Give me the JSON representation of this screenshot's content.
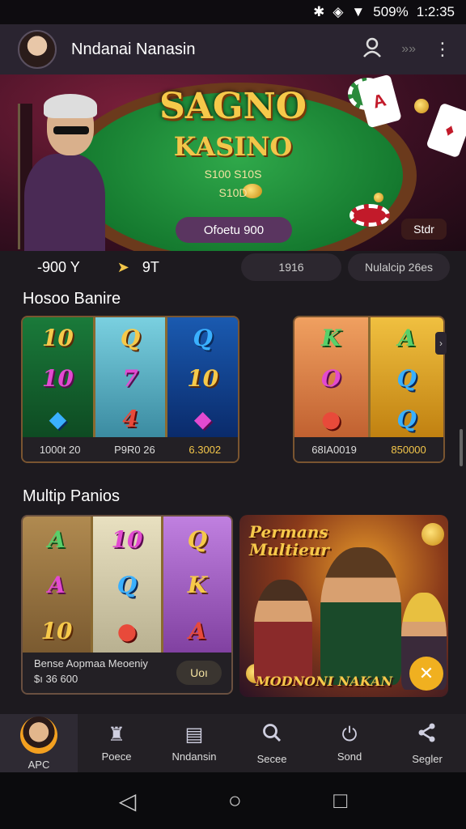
{
  "status_bar": {
    "battery": "​509%",
    "time": "1:2:35"
  },
  "header": {
    "title": "Nndanai Nanasin"
  },
  "hero": {
    "title": "SAGNO",
    "subtitle": "KASINO",
    "line1": "S100 S10S",
    "line2": "S10D",
    "cta_label": "Ofoetu 900",
    "tag": "Stdr"
  },
  "stats": {
    "balance": "-900 Υ",
    "points": "9T",
    "pill1": "1916",
    "pill2": "Nulalcip 26es"
  },
  "section1": {
    "title": "Hosoo Banire",
    "slot1": {
      "left": "1000t 20",
      "mid": "P9R0 26",
      "right": "6.3002"
    },
    "slot2": {
      "left": "68IA0019",
      "right": "850000"
    }
  },
  "section2": {
    "title": "Multip Panios",
    "card": {
      "line1": "Bense Aopmaa Meoeniy",
      "line2": "$ı 36 600",
      "button": "Uoı"
    },
    "promo": {
      "title_line1": "Permans",
      "title_line2": "Multieur",
      "bottom": "MODNONI NAKAN",
      "close": "✕"
    }
  },
  "bottom_nav": {
    "items": [
      {
        "label": "APC"
      },
      {
        "label": "Poece"
      },
      {
        "label": "Nndansin"
      },
      {
        "label": "Secee"
      },
      {
        "label": "Sond"
      },
      {
        "label": "Segler"
      }
    ]
  },
  "colors": {
    "accent": "#f6c94a",
    "brand": "#2a2430",
    "background": "#1d1a1f"
  }
}
